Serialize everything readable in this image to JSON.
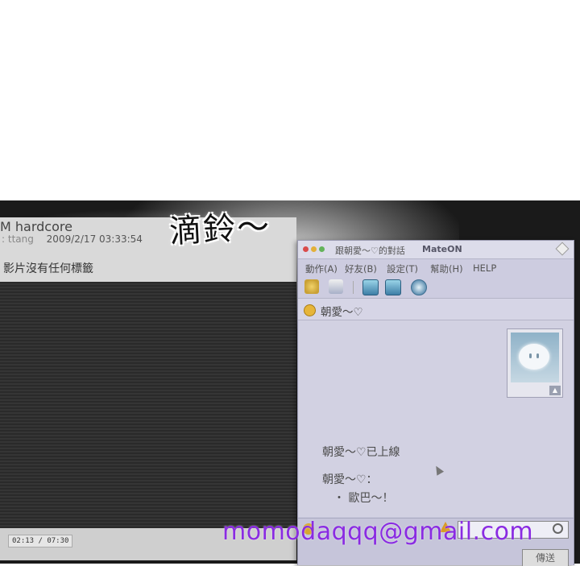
{
  "sfx_text": "滴鈴～",
  "video_page": {
    "title": "M hardcore",
    "user": ": ttang",
    "datetime": "2009/2/17 03:33:54",
    "no_tags": "影片沒有任何標籤",
    "time_display": "02:13 / 07:30"
  },
  "chat_window": {
    "title": "跟朝愛～♡的對話",
    "app_name": "MateON",
    "menu": [
      "動作(A)",
      "好友(B)",
      "設定(T)",
      "幫助(H)",
      "HELP"
    ],
    "buddy_name": "朝愛～♡",
    "messages": {
      "online": "朝愛～♡已上線",
      "sender": "朝愛～♡：",
      "content": "・ 歐巴～！"
    },
    "send_label": "傳送"
  },
  "watermark": "momodaqqq@gmail.com"
}
